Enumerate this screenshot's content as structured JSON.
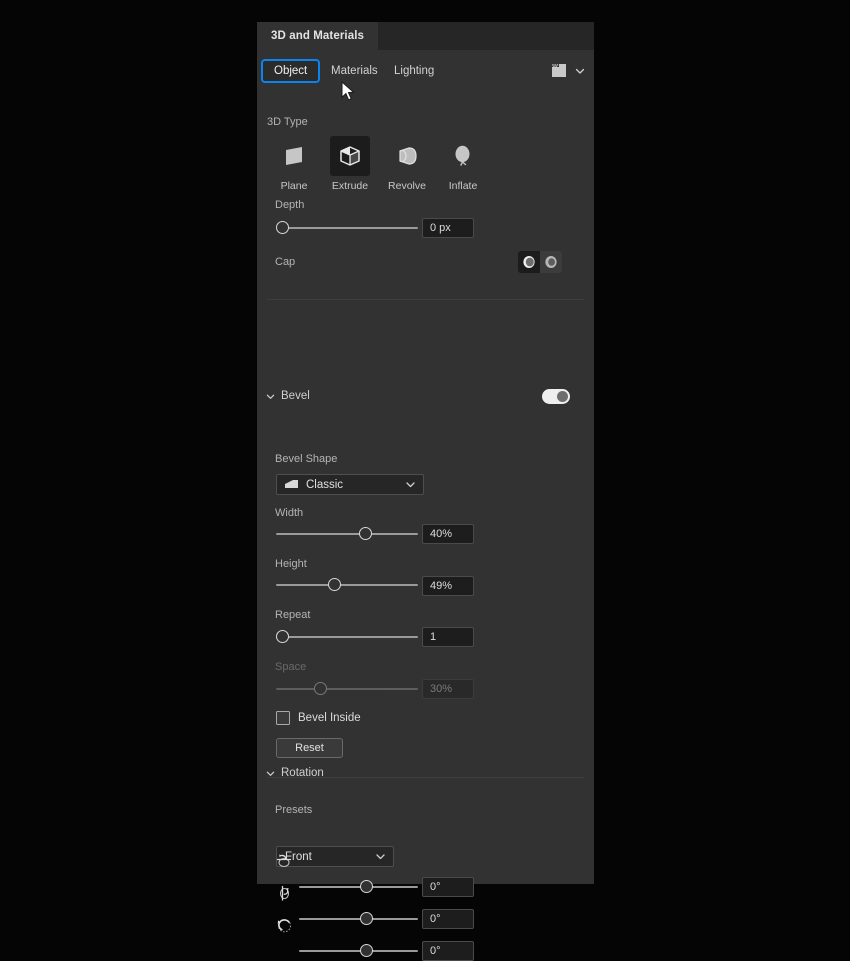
{
  "panel": {
    "tab_title": "3D and Materials",
    "render_icon": "render-settings-icon",
    "chevron_icon": "chevron-down-icon"
  },
  "subtabs": [
    {
      "label": "Object",
      "active": true
    },
    {
      "label": "Materials",
      "active": false
    },
    {
      "label": "Lighting",
      "active": false
    }
  ],
  "colors": {
    "accent_blue": "#0b84ef",
    "panel_bg": "#323232",
    "tabbar_bg": "#262626",
    "field_bg": "#1d1d1d",
    "track": "#9a9a9a"
  },
  "object": {
    "type_section_label": "3D Type",
    "types": [
      {
        "label": "Plane",
        "icon": "plane-icon",
        "selected": false
      },
      {
        "label": "Extrude",
        "icon": "extrude-icon",
        "selected": true
      },
      {
        "label": "Revolve",
        "icon": "revolve-icon",
        "selected": false
      },
      {
        "label": "Inflate",
        "icon": "inflate-icon",
        "selected": false
      }
    ],
    "depth": {
      "label": "Depth",
      "value": "0 px",
      "slider_pct": 0
    },
    "cap": {
      "label": "Cap",
      "options": [
        {
          "icon": "cap-solid-icon",
          "selected": true
        },
        {
          "icon": "cap-hollow-icon",
          "selected": false
        }
      ]
    }
  },
  "bevel": {
    "title": "Bevel",
    "enabled": true,
    "shape": {
      "label": "Bevel Shape",
      "value": "Classic",
      "icon": "bevel-classic-icon"
    },
    "width": {
      "label": "Width",
      "value": "40%",
      "slider_pct": 63,
      "disabled": false
    },
    "height": {
      "label": "Height",
      "value": "49%",
      "slider_pct": 42,
      "disabled": false
    },
    "repeat": {
      "label": "Repeat",
      "value": "1",
      "slider_pct": 0,
      "disabled": false
    },
    "space": {
      "label": "Space",
      "value": "30%",
      "slider_pct": 31,
      "disabled": true
    },
    "bevel_inside": {
      "label": "Bevel Inside",
      "checked": false
    },
    "reset_label": "Reset"
  },
  "rotation": {
    "title": "Rotation",
    "presets_label": "Presets",
    "preset_value": "Front",
    "axes": [
      {
        "icon": "rotate-x-icon",
        "value": "0°",
        "slider_pct": 57
      },
      {
        "icon": "rotate-y-icon",
        "value": "0°",
        "slider_pct": 57
      },
      {
        "icon": "rotate-z-icon",
        "value": "0°",
        "slider_pct": 57
      }
    ]
  }
}
